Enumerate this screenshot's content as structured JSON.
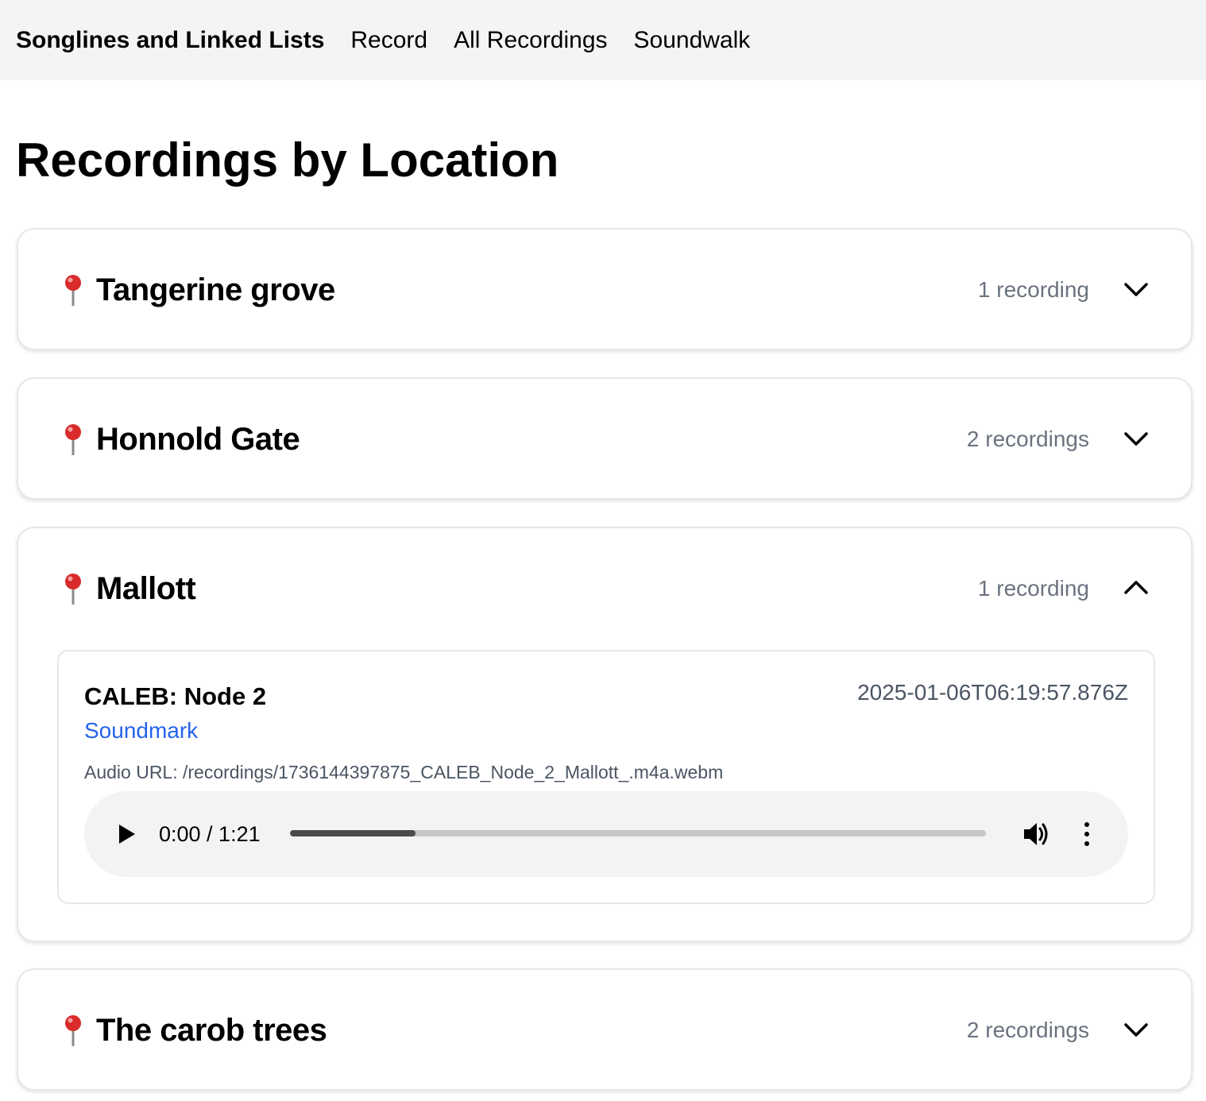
{
  "nav": {
    "brand": "Songlines and Linked Lists",
    "links": [
      "Record",
      "All Recordings",
      "Soundwalk"
    ]
  },
  "page_title": "Recordings by Location",
  "locations": [
    {
      "name": "Tangerine grove",
      "count": "1 recording",
      "expanded": false
    },
    {
      "name": "Honnold Gate",
      "count": "2 recordings",
      "expanded": false
    },
    {
      "name": "Mallott",
      "count": "1 recording",
      "expanded": true,
      "recording": {
        "title": "CALEB: Node 2",
        "date": "2025-01-06T06:19:57.876Z",
        "link_label": "Soundmark",
        "audio_url_text": "Audio URL: /recordings/1736144397875_CALEB_Node_2_Mallott_.m4a.webm",
        "player": {
          "time": "0:00 / 1:21",
          "progress_fraction": 0.18
        }
      }
    },
    {
      "name": "The carob trees",
      "count": "2 recordings",
      "expanded": false
    }
  ],
  "icons": {
    "pin": "pin-icon",
    "chevron_down": "chevron-down-icon",
    "chevron_up": "chevron-up-icon",
    "play": "play-icon",
    "volume": "volume-icon",
    "more": "more-vertical-icon"
  },
  "colors": {
    "nav_bg": "#f3f4f6",
    "link": "#2563eb",
    "muted": "#6b7280",
    "pin_red": "#d92b2b"
  }
}
